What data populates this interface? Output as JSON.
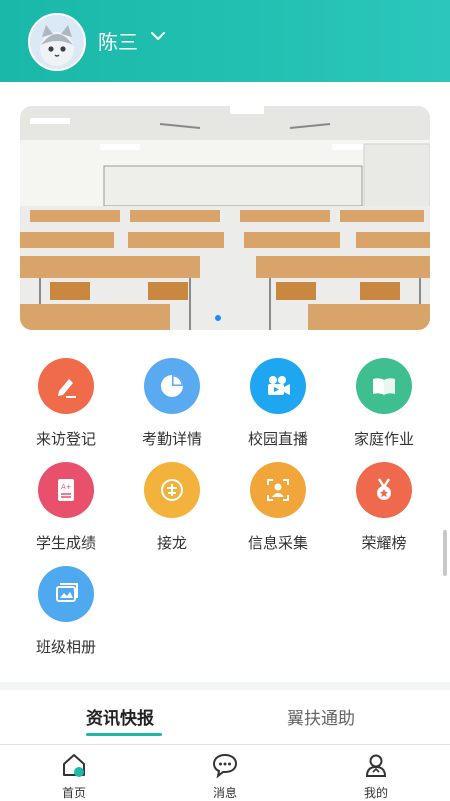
{
  "header": {
    "username": "陈三",
    "avatar_icon": "avatar-cat-icon",
    "dropdown_icon": "chevron-down-icon"
  },
  "banner": {
    "icon": "classroom-photo",
    "carousel_pages": 1,
    "active_page": 1
  },
  "grid": [
    {
      "label": "来访登记",
      "icon": "edit-icon",
      "color": "#ef6b4a"
    },
    {
      "label": "考勤详情",
      "icon": "pie-chart-icon",
      "color": "#5aaaf2"
    },
    {
      "label": "校园直播",
      "icon": "video-camera-icon",
      "color": "#1ea7f0"
    },
    {
      "label": "家庭作业",
      "icon": "book-icon",
      "color": "#3fbf8f"
    },
    {
      "label": "学生成绩",
      "icon": "grade-sheet-icon",
      "color": "#e8506b"
    },
    {
      "label": "接龙",
      "icon": "relay-icon",
      "color": "#f3b23c"
    },
    {
      "label": "信息采集",
      "icon": "profile-scan-icon",
      "color": "#f2a63a"
    },
    {
      "label": "荣耀榜",
      "icon": "medal-icon",
      "color": "#ef6a4c"
    },
    {
      "label": "班级相册",
      "icon": "photo-album-icon",
      "color": "#4fa9ef"
    }
  ],
  "tabs": {
    "active": "资讯快报",
    "inactive": "翼扶通助",
    "accent": "#1fb7a6"
  },
  "bottom_nav": [
    {
      "label": "首页",
      "icon": "home-icon"
    },
    {
      "label": "消息",
      "icon": "message-icon"
    },
    {
      "label": "我的",
      "icon": "profile-icon"
    }
  ],
  "colors": {
    "header": "#23c1b2"
  }
}
